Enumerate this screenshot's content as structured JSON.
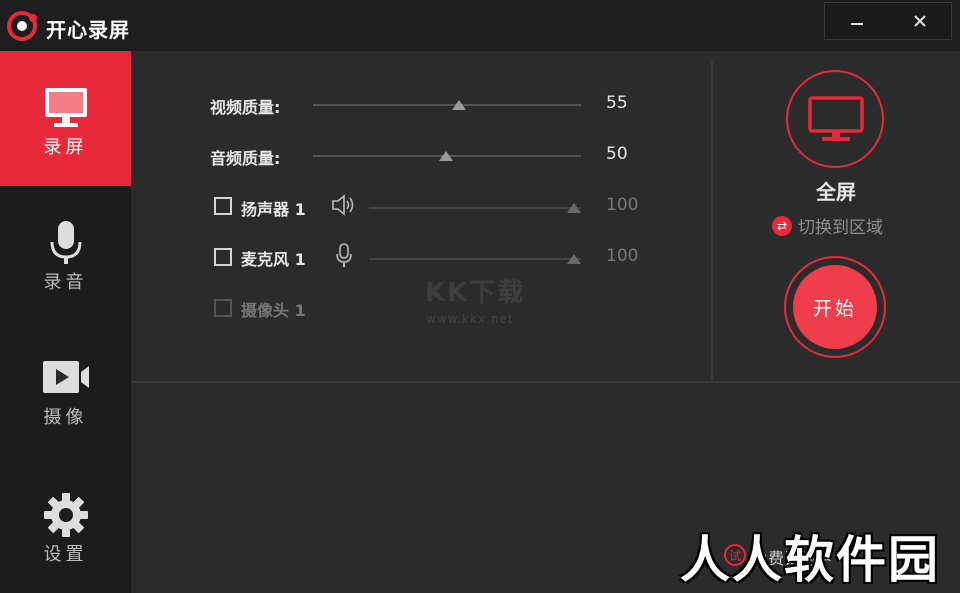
{
  "app": {
    "title": "开心录屏"
  },
  "window": {
    "minimize_label": "—",
    "close_label": "✕"
  },
  "sidebar": {
    "items": [
      {
        "label": "录屏",
        "icon": "monitor-icon",
        "active": true
      },
      {
        "label": "录音",
        "icon": "microphone-icon",
        "active": false
      },
      {
        "label": "摄像",
        "icon": "video-camera-icon",
        "active": false
      },
      {
        "label": "设置",
        "icon": "gear-icon",
        "active": false
      }
    ]
  },
  "settings": {
    "video_quality": {
      "label": "视频质量:",
      "value": "55"
    },
    "audio_quality": {
      "label": "音频质量:",
      "value": "50"
    },
    "speaker": {
      "label": "扬声器 1",
      "value": "100",
      "checked": false
    },
    "microphone": {
      "label": "麦克风 1",
      "value": "100",
      "checked": false
    },
    "camera": {
      "label": "摄像头 1",
      "checked": false,
      "disabled": true
    }
  },
  "capture": {
    "mode_label": "全屏",
    "switch_label": "切换到区域",
    "start_label": "开始"
  },
  "watermark": {
    "kk": "KK下载",
    "url": "www.kkx.net",
    "brand": "人人软件园"
  },
  "trial": {
    "badge": "试",
    "text": "免费试用中"
  },
  "colors": {
    "accent": "#e8293a",
    "sidebar_bg": "#1c1c1c",
    "panel_bg": "#2b2b2b"
  }
}
